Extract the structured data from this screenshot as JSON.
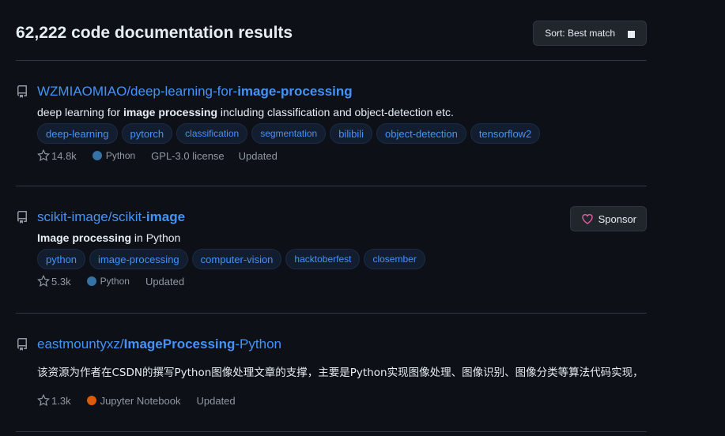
{
  "header": {
    "results_title": "62,222 code documentation results",
    "sort_label": "Sort: Best match"
  },
  "results": [
    {
      "owner": "WZMIAOMIAO/deep-learning-for-",
      "name_bold": "image-processing",
      "name_tail": "",
      "desc_prefix": "deep learning for ",
      "desc_bold": "image processing",
      "desc_suffix": " including classification and object-detection etc.",
      "topics": [
        "deep-learning",
        "pytorch",
        "classification",
        "segmentation",
        "bilibili",
        "object-detection",
        "tensorflow2"
      ],
      "stars": "14.8k",
      "language": "Python",
      "language_color": "#3572A5",
      "license": "GPL-3.0 license",
      "updated": "Updated"
    },
    {
      "owner": "scikit-image/scikit-",
      "name_bold": "image",
      "name_tail": "",
      "desc_prefix": "",
      "desc_bold": "Image processing",
      "desc_suffix": " in Python",
      "topics": [
        "python",
        "image-processing",
        "computer-vision",
        "hacktoberfest",
        "closember"
      ],
      "stars": "5.3k",
      "language": "Python",
      "language_color": "#3572A5",
      "updated": "Updated",
      "sponsor_label": "Sponsor"
    },
    {
      "owner": "eastmountyxz/",
      "name_bold": "ImageProcessing",
      "name_tail": "-Python",
      "desc": "该资源为作者在CSDN的撰写Python图像处理文章的支撑，主要是Python实现图像处理、图像识别、图像分类等算法代码实现，",
      "stars": "1.3k",
      "language": "Jupyter Notebook",
      "language_color": "#DA5B0B",
      "updated": "Updated"
    }
  ],
  "colors": {
    "background": "#0d1117",
    "link": "#4493f8",
    "muted": "#9198a1",
    "sponsor_heart": "#db61a2"
  }
}
